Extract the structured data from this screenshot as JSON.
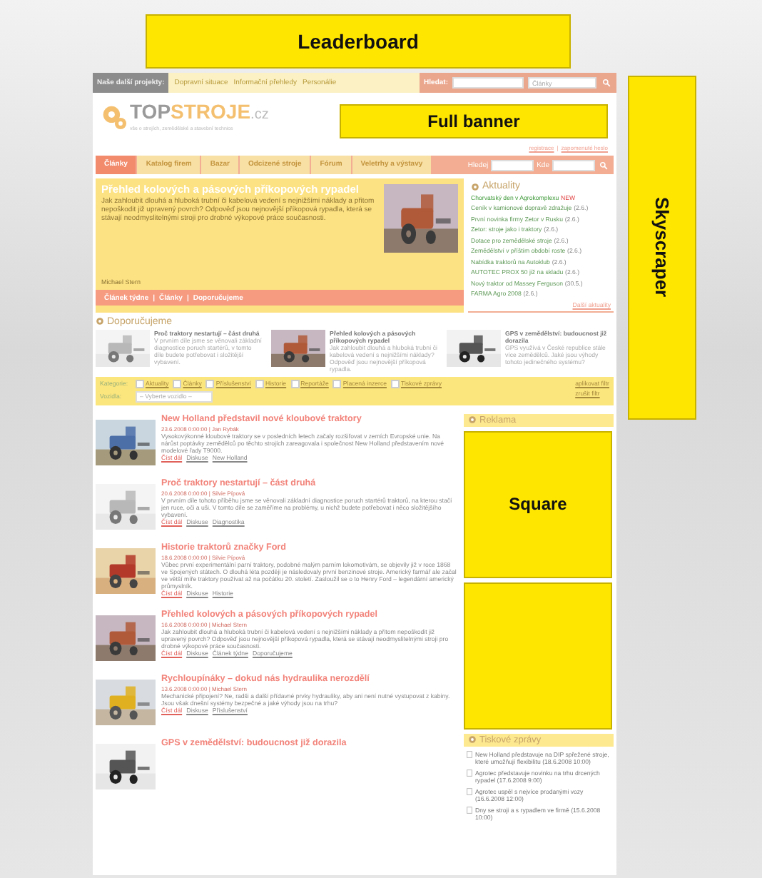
{
  "ads": {
    "leaderboard": "Leaderboard",
    "full_banner": "Full banner",
    "skyscraper": "Skyscraper",
    "square": "Square"
  },
  "top_bar": {
    "label": "Naše další projekty:",
    "links": [
      "Dopravní situace",
      "Informační přehledy",
      "Personálie"
    ],
    "search_label": "Hledat:",
    "search_select": "Články"
  },
  "logo": {
    "top": "TOP",
    "stroje": "STROJE",
    "domain": ".cz",
    "tagline": "vše o strojích, zemědělské a stavební technice"
  },
  "account_links": [
    "registrace",
    "zapomenuté heslo"
  ],
  "account_separator": "|",
  "nav": {
    "tabs": [
      {
        "label": "Články",
        "selected": true
      },
      {
        "label": "Katalog firem",
        "selected": false
      },
      {
        "label": "Bazar",
        "selected": false
      },
      {
        "label": "Odcizené stroje",
        "selected": false
      },
      {
        "label": "Fórum",
        "selected": false
      },
      {
        "label": "Veletrhy a výstavy",
        "selected": false
      }
    ],
    "search_fields": [
      "Hledej",
      "Kde"
    ]
  },
  "featured": {
    "title": "Přehled kolových a pásových příkopových rypadel",
    "text": "Jak zahloubit dlouhá a hluboká trubní či kabelová vedení s nejnižšími náklady a přitom nepoškodit již upravený povrch? Odpověď jsou nejnovější příkopová rypadla, která se stávají neodmyslitelnými stroji pro drobné výkopové práce současnosti.",
    "author": "Michael Stern",
    "links": [
      "Článek týdne",
      "Články",
      "Doporučujeme"
    ],
    "link_separator": "|"
  },
  "news": {
    "title": "Aktuality",
    "items": [
      {
        "text": "Chorvatský den v Agrokomplexu",
        "badge": "NEW"
      },
      {
        "text": "Ceník v kamionové dopravě zdražuje",
        "date": "(2.6.)"
      },
      {
        "text": "První novinka firmy Zetor v Rusku",
        "date": "(2.6.)"
      },
      {
        "text": "Zetor: stroje jako i traktory",
        "date": "(2.6.)"
      },
      {
        "text": "Dotace pro zemědělské stroje",
        "date": "(2.6.)"
      },
      {
        "text": "Zemědělství v příštím období roste",
        "date": "(2.6.)"
      },
      {
        "text": "Nabídka traktorů na Autoklub",
        "date": "(2.6.)"
      },
      {
        "text": "AUTOTEC PROX 50 již na skladu",
        "date": "(2.6.)"
      },
      {
        "text": "Nový traktor od Massey Ferguson",
        "date": "(30.5.)"
      },
      {
        "text": "FARMA Agro 2008",
        "date": "(2.6.)"
      }
    ],
    "more": "Další aktuality"
  },
  "recommended": {
    "title": "Doporučujeme",
    "items": [
      {
        "title": "Proč traktory nestartují – část druhá",
        "text": "V prvním díle jsme se věnovali základní diagnostice poruch startérů, v tomto díle budete potřebovat i složitější vybavení."
      },
      {
        "title": "Přehled kolových a pásových příkopových rypadel",
        "text": "Jak zahloubit dlouhá a hluboká trubní či kabelová vedení s nejnižšími náklady? Odpověď jsou nejnovější příkopová rypadla."
      },
      {
        "title": "GPS v zemědělství: budoucnost již dorazila",
        "text": "GPS využívá v České republice stále více zemědělců. Jaké jsou výhody tohoto jedinečného systému?"
      }
    ]
  },
  "filter": {
    "category_label": "Kategorie:",
    "categories": [
      {
        "label": "Aktuality",
        "checked": false
      },
      {
        "label": "Články",
        "checked": false
      },
      {
        "label": "Příslušenství",
        "checked": false
      },
      {
        "label": "Historie",
        "checked": false
      },
      {
        "label": "Reportáže",
        "checked": false
      },
      {
        "label": "Placená inzerce",
        "checked": false
      },
      {
        "label": "Tiskové zprávy",
        "checked": false
      }
    ],
    "vehicle_label": "Vozidla:",
    "vehicle_select": "– Vyberte vozidlo –",
    "actions": [
      "aplikovat filtr",
      "zrušit filtr"
    ]
  },
  "articles": [
    {
      "title": "New Holland představil nové kloubové traktory",
      "meta": "23.6.2008 0:00:00 | Jan Rybák",
      "text": "Vysokovýkonné kloubové traktory se v posledních letech začaly rozšiřovat v zemích Evropské unie. Na nárůst poptávky zemědělců po těchto strojích zareagovala i společnost New Holland představením nové modelové řady T9000.",
      "links": [
        "Číst dál",
        "Diskuse",
        "New Holland"
      ]
    },
    {
      "title": "Proč traktory nestartují – část druhá",
      "meta": "20.6.2008 0:00:00 | Silvie Pípová",
      "text": "V prvním díle tohoto příběhu jsme se věnovali základní diagnostice poruch startérů traktorů, na kterou stačí jen ruce, oči a uši. V tomto díle se zaměříme na problémy, u nichž budete potřebovat i něco složitějšího vybavení.",
      "links": [
        "Číst dál",
        "Diskuse",
        "Diagnostika"
      ]
    },
    {
      "title": "Historie traktorů značky Ford",
      "meta": "18.6.2008 0:00:00 | Silvie Pípová",
      "text": "Vůbec první experimentální parní traktory, podobné malým parním lokomotivám, se objevily již v roce 1868 ve Spojených státech. O dlouhá léta později je následovaly první benzinové stroje. Americký farmář ale začal ve větší míře traktory používat až na počátku 20. století. Zasloužil se o to Henry Ford – legendární americký průmyslník.",
      "links": [
        "Číst dál",
        "Diskuse",
        "Historie"
      ]
    },
    {
      "title": "Přehled kolových a pásových příkopových rypadel",
      "meta": "16.6.2008 0:00:00 | Michael Stern",
      "text": "Jak zahloubit dlouhá a hluboká trubní či kabelová vedení s nejnižšími náklady a přitom nepoškodit již upravený povrch? Odpověď jsou nejnovější příkopová rypadla, která se stávají neodmyslitelnými stroji pro drobné výkopové práce současnosti.",
      "links": [
        "Číst dál",
        "Diskuse",
        "Článek týdne",
        "Doporučujeme"
      ]
    },
    {
      "title": "Rychloupínáky – dokud nás hydraulika nerozdělí",
      "meta": "13.6.2008 0:00:00 | Michael Stern",
      "text": "Mechanické připojení? Ne, radši a další přídavné prvky hydrauliky, aby ani není nutné vystupovat z kabiny. Jsou však dnešní systémy bezpečné a jaké výhody jsou na trhu?",
      "links": [
        "Číst dál",
        "Diskuse",
        "Příslušenství"
      ]
    },
    {
      "title": "GPS v zemědělství: budoucnost již dorazila"
    }
  ],
  "sidebar": {
    "ad_title": "Reklama",
    "press_title": "Tiskové zprávy",
    "press": [
      {
        "text": "New Holland představuje na DIP spřežené stroje, které umožňují flexibilitu",
        "date": "(18.6.2008 10:00)"
      },
      {
        "text": "Agrotec představuje novinku na trhu drcených rypadel",
        "date": "(17.6.2008 9:00)"
      },
      {
        "text": "Agrotec uspěl s nejvíce prodanými vozy",
        "date": "(16.6.2008 12:00)"
      },
      {
        "text": "Dny se stroji a s rypadlem ve firmě",
        "date": "(15.6.2008 10:00)"
      }
    ]
  }
}
